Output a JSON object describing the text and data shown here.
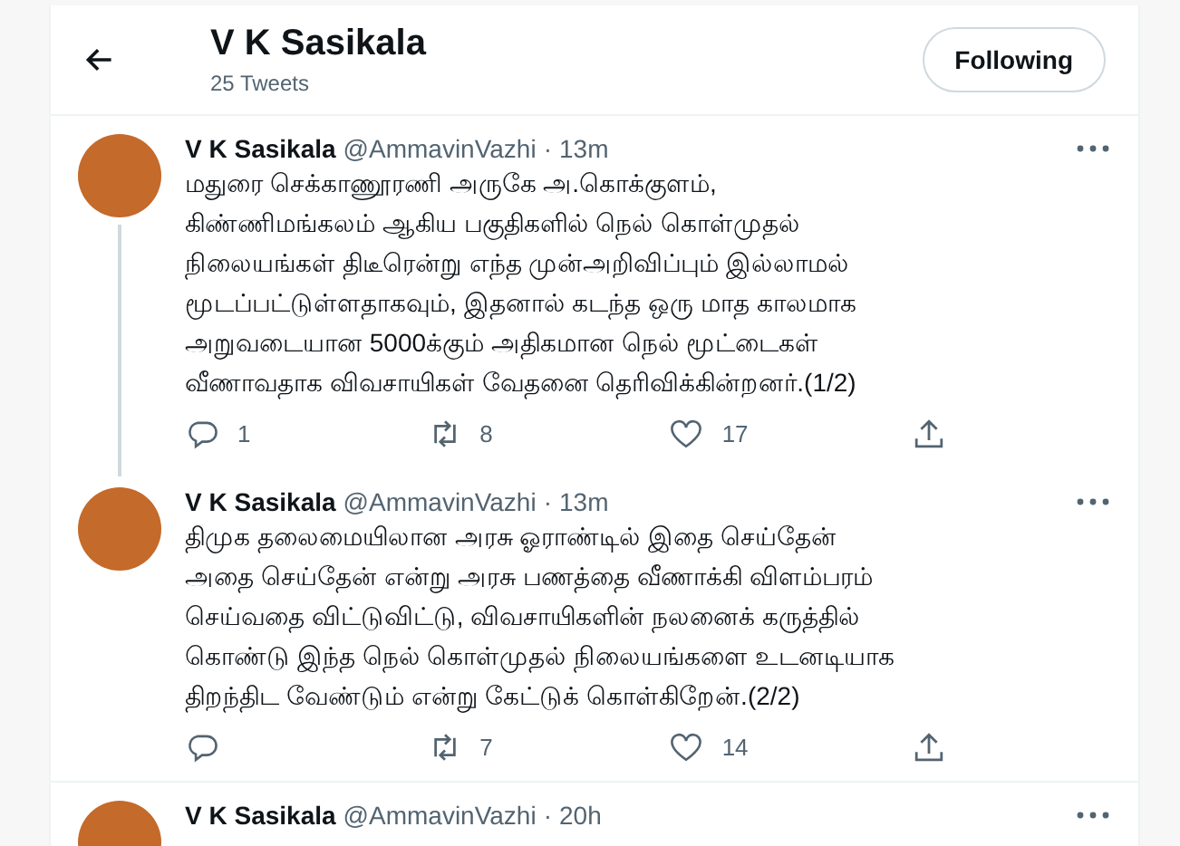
{
  "header": {
    "title": "V K Sasikala",
    "subtitle": "25 Tweets",
    "follow_button": "Following"
  },
  "separator": "·",
  "tweets": [
    {
      "name": "V K Sasikala",
      "handle": "@AmmavinVazhi",
      "time": "13m",
      "thread_line": true,
      "text": "மதுரை செக்காணூரணி அருகே அ.கொக்குளம்,\nகிண்ணிமங்கலம் ஆகிய பகுதிகளில் நெல் கொள்முதல்\nநிலையங்கள் திடீரென்று எந்த முன்அறிவிப்பும் இல்லாமல்\nமூடப்பட்டுள்ளதாகவும், இதனால் கடந்த ஒரு மாத காலமாக\nஅறுவடையான 5000க்கும் அதிகமான நெல் மூட்டைகள்\nவீணாவதாக விவசாயிகள் வேதனை தெரிவிக்கின்றனர்.(1/2)",
      "replies": "1",
      "retweets": "8",
      "likes": "17"
    },
    {
      "name": "V K Sasikala",
      "handle": "@AmmavinVazhi",
      "time": "13m",
      "thread_line": false,
      "text": "திமுக தலைமையிலான அரசு ஓராண்டில் இதை செய்தேன்\nஅதை செய்தேன் என்று அரசு பணத்தை வீணாக்கி விளம்பரம்\nசெய்வதை விட்டுவிட்டு, விவசாயிகளின் நலனைக் கருத்தில்\nகொண்டு இந்த நெல் கொள்முதல் நிலையங்களை உடனடியாக\nதிறந்திட வேண்டும் என்று கேட்டுக் கொள்கிறேன்.(2/2)",
      "retweets": "7",
      "likes": "14"
    },
    {
      "name": "V K Sasikala",
      "handle": "@AmmavinVazhi",
      "time": "20h"
    }
  ]
}
